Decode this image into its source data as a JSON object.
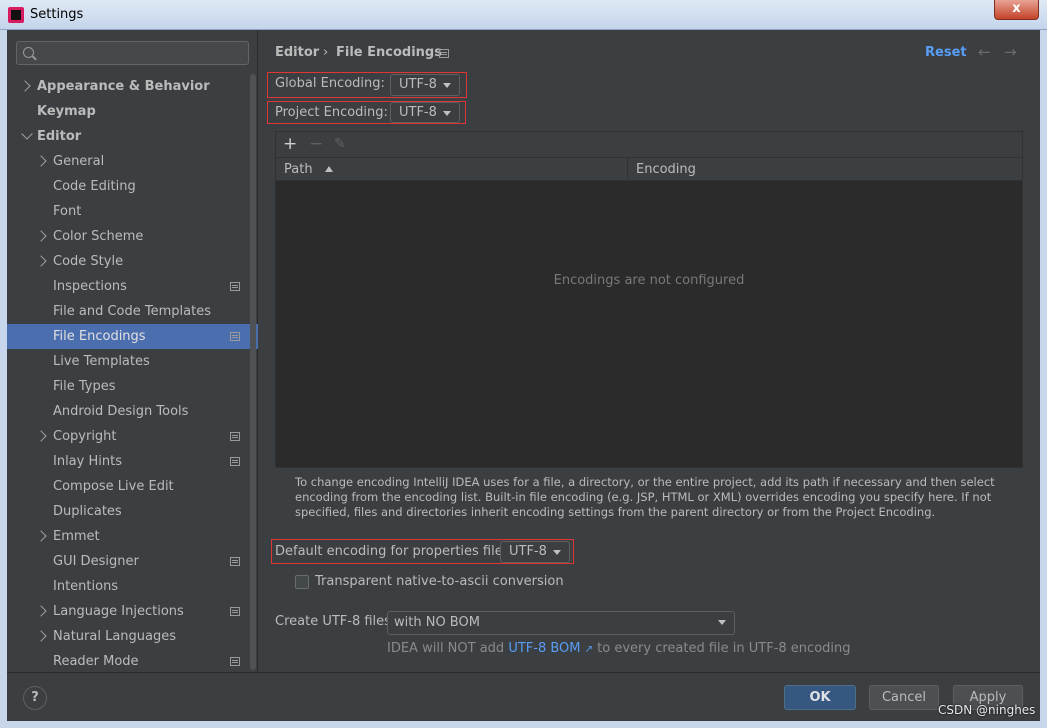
{
  "window": {
    "title": "Settings",
    "close_glyph": "x"
  },
  "sidebar": {
    "search_placeholder": "",
    "items": [
      {
        "label": "Appearance & Behavior"
      },
      {
        "label": "Keymap"
      },
      {
        "label": "Editor"
      },
      {
        "label": "General"
      },
      {
        "label": "Code Editing"
      },
      {
        "label": "Font"
      },
      {
        "label": "Color Scheme"
      },
      {
        "label": "Code Style"
      },
      {
        "label": "Inspections"
      },
      {
        "label": "File and Code Templates"
      },
      {
        "label": "File Encodings"
      },
      {
        "label": "Live Templates"
      },
      {
        "label": "File Types"
      },
      {
        "label": "Android Design Tools"
      },
      {
        "label": "Copyright"
      },
      {
        "label": "Inlay Hints"
      },
      {
        "label": "Compose Live Edit"
      },
      {
        "label": "Duplicates"
      },
      {
        "label": "Emmet"
      },
      {
        "label": "GUI Designer"
      },
      {
        "label": "Intentions"
      },
      {
        "label": "Language Injections"
      },
      {
        "label": "Natural Languages"
      },
      {
        "label": "Reader Mode"
      }
    ]
  },
  "header": {
    "breadcrumb_parent": "Editor",
    "breadcrumb_separator": "›",
    "breadcrumb_current": "File Encodings",
    "reset_label": "Reset",
    "back_glyph": "←",
    "forward_glyph": "→"
  },
  "encoding": {
    "global_label": "Global Encoding:",
    "global_value": "UTF-8",
    "project_label": "Project Encoding:",
    "project_value": "UTF-8"
  },
  "table": {
    "add_glyph": "+",
    "remove_glyph": "−",
    "edit_glyph": "✎",
    "columns": [
      "Path",
      "Encoding"
    ],
    "empty_text": "Encodings are not configured"
  },
  "help_text": "To change encoding IntelliJ IDEA uses for a file, a directory, or the entire project, add its path if necessary and then select encoding from the encoding list. Built-in file encoding (e.g. JSP, HTML or XML) overrides encoding you specify here. If not specified, files and directories inherit encoding settings from the parent directory or from the Project Encoding.",
  "properties": {
    "label": "Default encoding for properties files:",
    "value": "UTF-8",
    "transparent_label": "Transparent native-to-ascii conversion"
  },
  "utf8_files": {
    "label": "Create UTF-8 files:",
    "value": "with NO BOM",
    "note_prefix": "IDEA will NOT add",
    "note_link": "UTF-8 BOM",
    "ext_glyph": "↗",
    "note_suffix": "to every created file in UTF-8 encoding"
  },
  "footer": {
    "help_glyph": "?",
    "ok_label": "OK",
    "cancel_label": "Cancel",
    "apply_label": "Apply"
  },
  "watermark": "CSDN @ninghes",
  "colors": {
    "accent": "#589df6",
    "selection": "#4b6eaf",
    "highlight_box": "#e03535",
    "primary_button": "#365880"
  }
}
